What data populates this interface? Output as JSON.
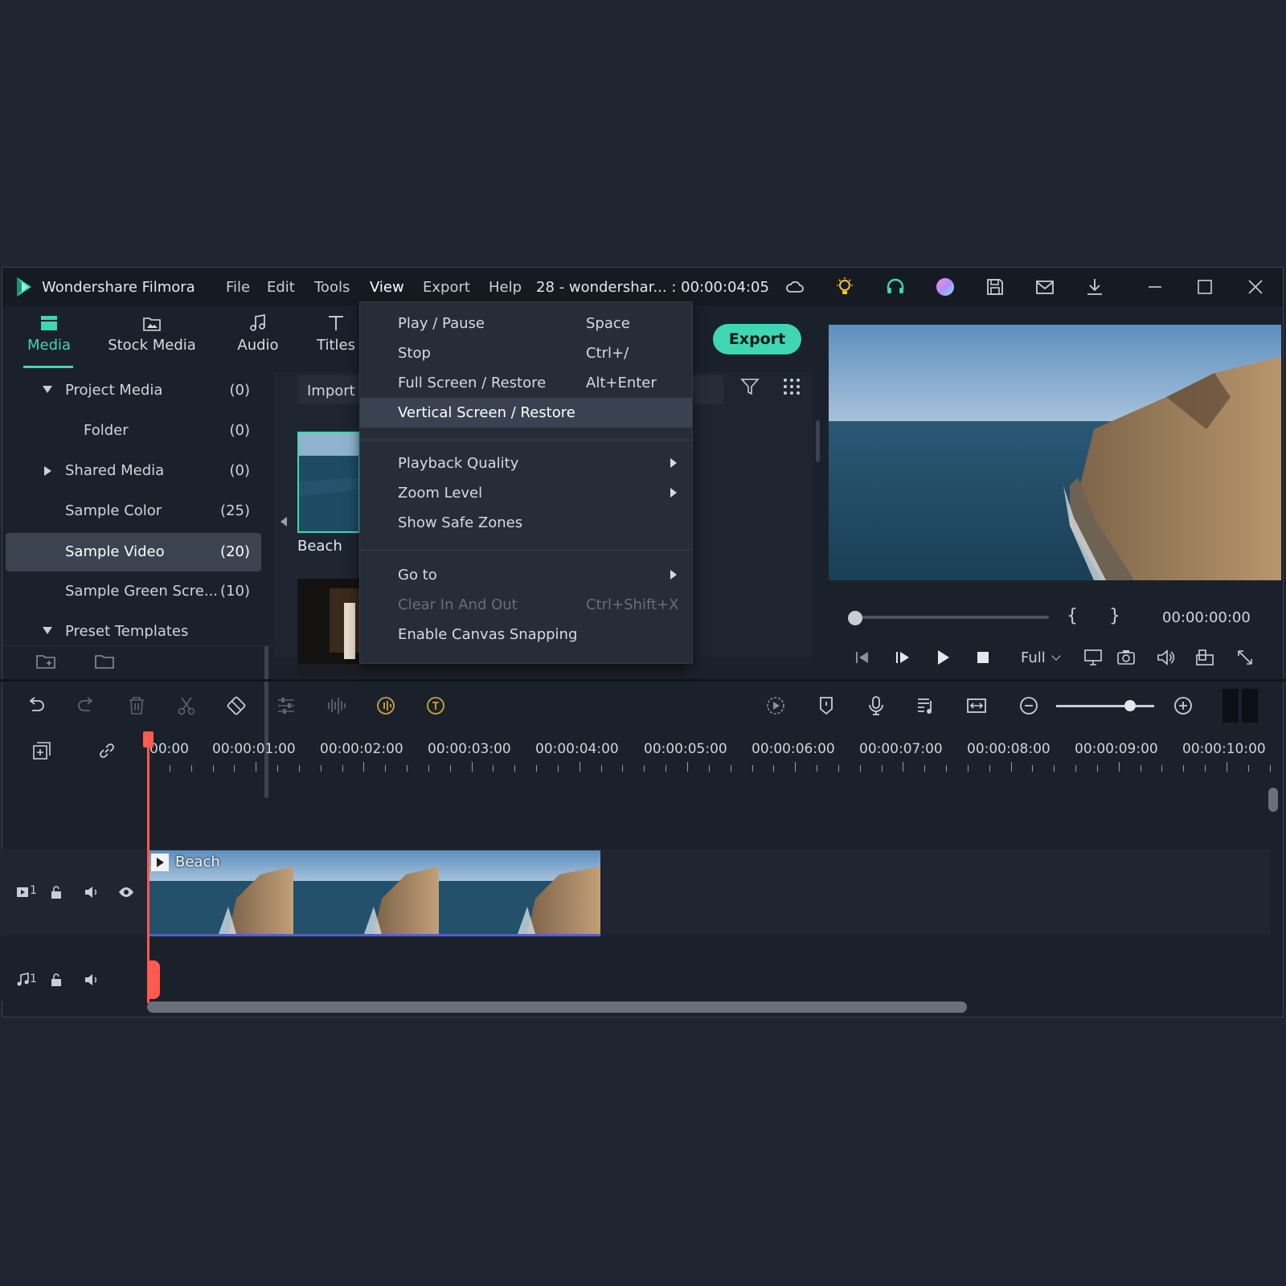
{
  "titlebar": {
    "app_title": "Wondershare Filmora",
    "menus": [
      "File",
      "Edit",
      "Tools",
      "View",
      "Export",
      "Help"
    ],
    "project": "28 - wondershar... : 00:00:04:05"
  },
  "tabs": [
    {
      "label": "Media",
      "icon": "media-icon"
    },
    {
      "label": "Stock Media",
      "icon": "stock-media-icon"
    },
    {
      "label": "Audio",
      "icon": "audio-icon"
    },
    {
      "label": "Titles",
      "icon": "titles-icon"
    }
  ],
  "export_label": "Export",
  "tree": [
    {
      "label": "Project Media",
      "count": "(0)",
      "caret": "down"
    },
    {
      "label": "Folder",
      "count": "(0)",
      "caret": ""
    },
    {
      "label": "Shared Media",
      "count": "(0)",
      "caret": "right"
    },
    {
      "label": "Sample Color",
      "count": "(25)",
      "caret": ""
    },
    {
      "label": "Sample Video",
      "count": "(20)",
      "caret": "",
      "selected": true
    },
    {
      "label": "Sample Green Scre...",
      "count": "(10)",
      "caret": ""
    },
    {
      "label": "Preset Templates",
      "count": "",
      "caret": "down"
    }
  ],
  "media": {
    "import_label": "Import",
    "thumb_label": "Beach"
  },
  "view_menu": {
    "items": [
      {
        "label": "Play / Pause",
        "shortcut": "Space"
      },
      {
        "label": "Stop",
        "shortcut": "Ctrl+/"
      },
      {
        "label": "Full Screen / Restore",
        "shortcut": "Alt+Enter"
      },
      {
        "label": "Vertical Screen / Restore",
        "shortcut": "",
        "highlighted": true
      },
      {
        "label": "Playback Quality",
        "shortcut": "",
        "submenu": true
      },
      {
        "label": "Zoom Level",
        "shortcut": "",
        "submenu": true
      },
      {
        "label": "Show Safe Zones",
        "shortcut": ""
      },
      {
        "label": "Go to",
        "shortcut": "",
        "submenu": true
      },
      {
        "label": "Clear In And Out",
        "shortcut": "Ctrl+Shift+X",
        "disabled": true
      },
      {
        "label": "Enable Canvas Snapping",
        "shortcut": ""
      }
    ]
  },
  "preview": {
    "timecode": "00:00:00:00",
    "quality": "Full",
    "mark_in": "{",
    "mark_out": "}"
  },
  "ruler": {
    "labels": [
      "00:00",
      "00:00:01:00",
      "00:00:02:00",
      "00:00:03:00",
      "00:00:04:00",
      "00:00:05:00",
      "00:00:06:00",
      "00:00:07:00",
      "00:00:08:00",
      "00:00:09:00",
      "00:00:10:00"
    ]
  },
  "tracks": {
    "video_clip_label": "Beach",
    "video_track": "1",
    "audio_track": "1"
  },
  "colors": {
    "accent": "#3fd6b3",
    "playhead": "#ff5a4e",
    "clip_border": "#5260d0"
  }
}
